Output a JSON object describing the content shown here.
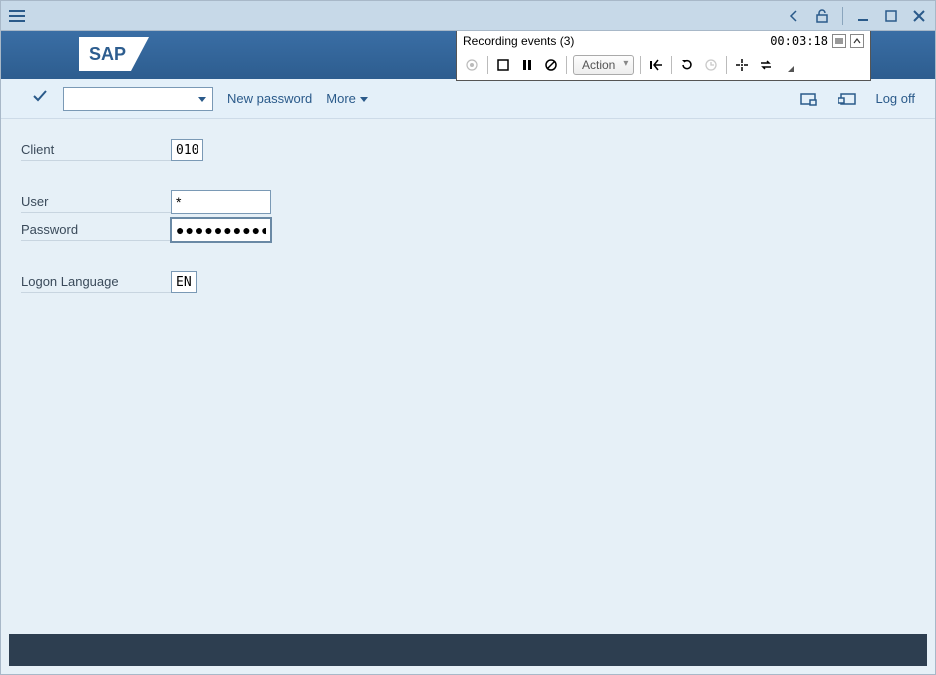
{
  "recording": {
    "title": "Recording events  (3)",
    "time": "00:03:18",
    "action_label": "Action"
  },
  "toolbar": {
    "new_password": "New password",
    "more": "More",
    "logoff": "Log off"
  },
  "form": {
    "client_label": "Client",
    "client_value": "010",
    "user_label": "User",
    "user_value": "*",
    "password_label": "Password",
    "password_value": "●●●●●●●●●●●●",
    "language_label": "Logon Language",
    "language_value": "EN"
  }
}
